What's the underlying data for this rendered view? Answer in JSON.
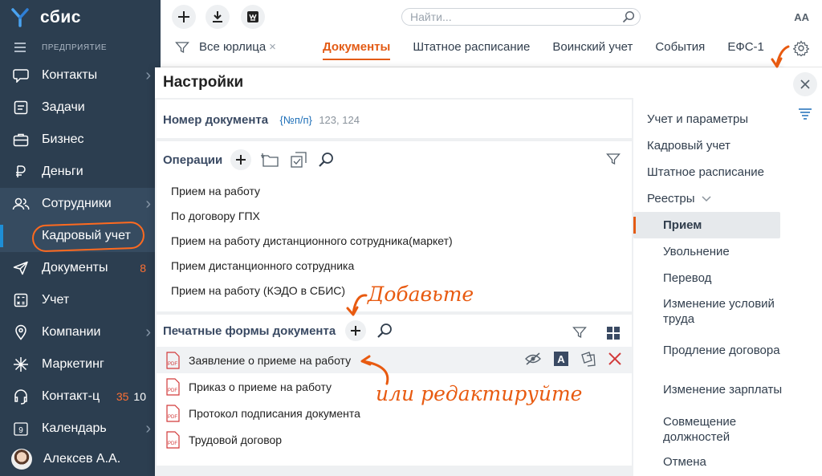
{
  "app": {
    "logo_text": "сбис",
    "company_label": "ПРЕДПРИЯТИЕ"
  },
  "sidebar": {
    "items": [
      {
        "label": "Контакты",
        "icon": "chat-icon",
        "chevron": "›"
      },
      {
        "label": "Задачи",
        "icon": "tasks-icon"
      },
      {
        "label": "Бизнес",
        "icon": "briefcase-icon"
      },
      {
        "label": "Деньги",
        "icon": "money-icon"
      },
      {
        "label": "Сотрудники",
        "icon": "people-icon",
        "chevron": "›"
      },
      {
        "label": "Документы",
        "icon": "send-icon",
        "count": "8"
      },
      {
        "label": "Учет",
        "icon": "calculator-icon"
      },
      {
        "label": "Компании",
        "icon": "location-icon",
        "chevron": "›"
      },
      {
        "label": "Маркетинг",
        "icon": "spark-icon"
      },
      {
        "label": "Контакт-ц",
        "icon": "headset-icon",
        "count_orange": "35",
        "count": "10"
      },
      {
        "label": "Календарь",
        "icon": "calendar-icon",
        "day": "9",
        "chevron": "›"
      }
    ],
    "sub_item": "Кадровый учет",
    "user": "Алексев А.А."
  },
  "topbar": {
    "search_placeholder": "Найти...",
    "font_size_label": "AA",
    "filter_label": "Все юрлица",
    "filter_clear": "×",
    "tabs": [
      "Документы",
      "Штатное расписание",
      "Воинский учет",
      "События",
      "ЕФС-1"
    ]
  },
  "settings": {
    "title": "Настройки",
    "doc_number": {
      "label": "Номер документа",
      "template": "{№п/п}",
      "example": "123, 124"
    },
    "operations": {
      "title": "Операции",
      "items": [
        "Прием на работу",
        "По договору ГПХ",
        "Прием на работу дистанционного сотрудника(маркет)",
        "Прием дистанционного сотрудника",
        "Прием на работу (КЭДО в СБИС)"
      ]
    },
    "print_forms": {
      "title": "Печатные формы документа",
      "items": [
        "Заявление о приеме на работу",
        "Приказ о приеме на работу",
        "Протокол подписания документа",
        "Трудовой договор"
      ]
    },
    "right_nav": [
      {
        "label": "Учет и параметры",
        "level": 0
      },
      {
        "label": "Кадровый учет",
        "level": 0
      },
      {
        "label": "Штатное расписание",
        "level": 0
      },
      {
        "label": "Реестры",
        "level": 0,
        "expanded": true
      },
      {
        "label": "Прием",
        "level": 1,
        "selected": true
      },
      {
        "label": "Увольнение",
        "level": 1
      },
      {
        "label": "Перевод",
        "level": 1
      },
      {
        "label": "Изменение условий труда",
        "level": 1
      },
      {
        "label": "Продление договора",
        "level": 1
      },
      {
        "label": "Изменение зарплаты",
        "level": 1
      },
      {
        "label": "Совмещение должностей",
        "level": 1
      },
      {
        "label": "Отмена",
        "level": 1
      }
    ]
  },
  "annotations": {
    "add": "Добавьте",
    "edit": "или редактируйте"
  },
  "colors": {
    "sidebar_bg": "#2c3e50",
    "accent": "#e35b15",
    "annotation": "#e85a10",
    "link_blue": "#1e6fb8"
  }
}
